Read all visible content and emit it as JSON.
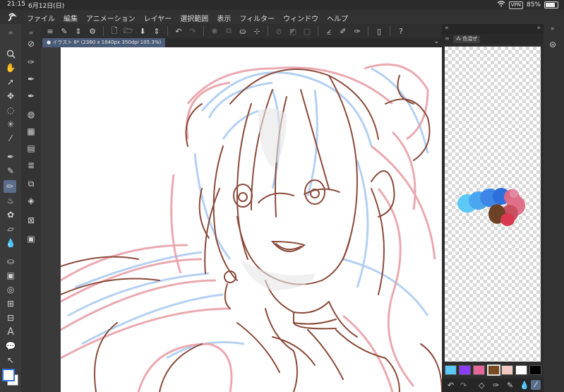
{
  "status": {
    "time": "21:15",
    "date": "6月12日(日)",
    "vpn": "VPN",
    "battery_pct": "85%",
    "battery_level": 0.85
  },
  "menu": {
    "items": [
      "ファイル",
      "編集",
      "アニメーション",
      "レイヤー",
      "選択範囲",
      "表示",
      "フィルター",
      "ウィンドウ",
      "ヘルプ"
    ]
  },
  "canvas_tab": {
    "label": "● イラスト 8* (2360 x 1640px 350dpi 105.3%)"
  },
  "color_mixer": {
    "tab_label": "色混ぜ"
  },
  "swatches": [
    {
      "color": "#5bc8f5",
      "name": "light-blue-swatch"
    },
    {
      "color": "#8b3cf7",
      "name": "purple-swatch"
    },
    {
      "color": "#e8679a",
      "name": "pink-swatch"
    },
    {
      "color": "#7a4a22",
      "name": "brown-swatch",
      "selected": true
    },
    {
      "color": "#f2c9c0",
      "name": "skin-swatch"
    },
    {
      "color": "#ffffff",
      "name": "white-swatch"
    },
    {
      "color": "#000000",
      "name": "black-swatch"
    }
  ],
  "colors": {
    "fg": "#ffffff",
    "bg": "#ffffff",
    "line_brown": "#8a4a3a",
    "line_pink": "#e8a0a8",
    "line_blue": "#a8c8f0"
  }
}
